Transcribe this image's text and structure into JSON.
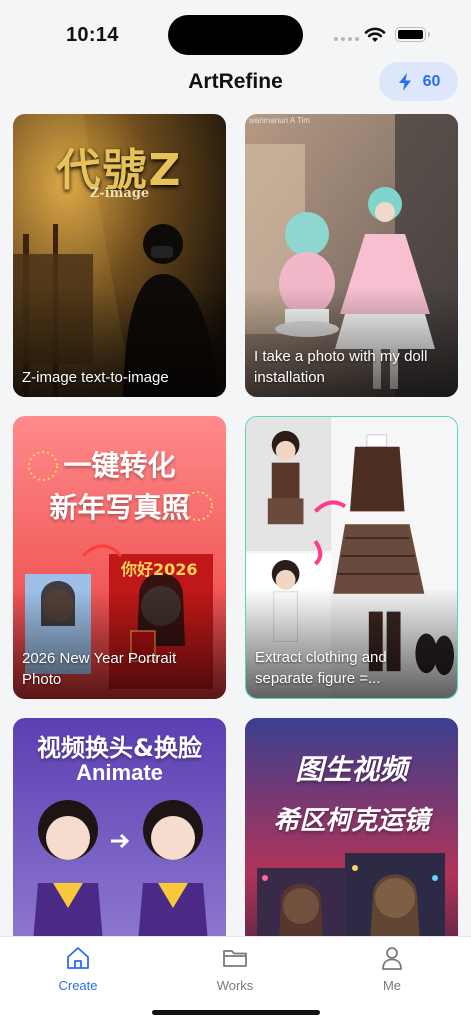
{
  "status_bar": {
    "time": "10:14"
  },
  "header": {
    "title": "ArtRefine",
    "credits": "60"
  },
  "cards": [
    {
      "label": "Z-image text-to-image",
      "overlay_title": "代號Z",
      "overlay_subtitle": "Z-image"
    },
    {
      "label": "I take a photo with my doll installation",
      "watermark": "wanmanun A Tim"
    },
    {
      "label": "2026 New Year Portrait Photo",
      "overlay_line1": "一键转化",
      "overlay_line2": "新年写真照",
      "sign_text": "你好2026"
    },
    {
      "label": "Extract clothing and separate figure =..."
    },
    {
      "label": "",
      "overlay_line1": "视频换头&换脸",
      "overlay_line2": "Animate"
    },
    {
      "label": "",
      "overlay_line1": "图生视频",
      "overlay_line2": "希区柯克运镜"
    }
  ],
  "tabs": [
    {
      "label": "Create",
      "icon": "home-icon",
      "active": true
    },
    {
      "label": "Works",
      "icon": "folder-icon",
      "active": false
    },
    {
      "label": "Me",
      "icon": "person-icon",
      "active": false
    }
  ],
  "colors": {
    "accent": "#2a6ef0",
    "credits_bg": "#dde6fb"
  }
}
